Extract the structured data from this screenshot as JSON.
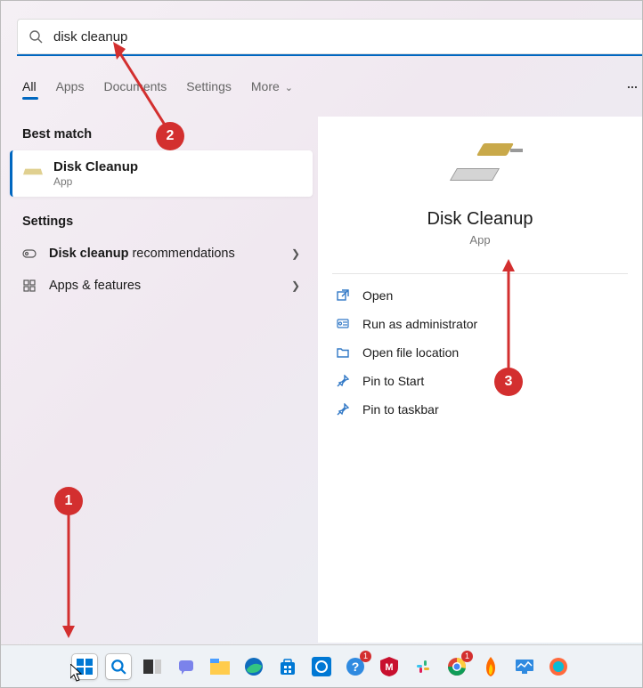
{
  "search": {
    "value": "disk cleanup"
  },
  "tabs": {
    "all": "All",
    "apps": "Apps",
    "documents": "Documents",
    "settings": "Settings",
    "more": "More"
  },
  "headers": {
    "best_match": "Best match",
    "settings": "Settings"
  },
  "best": {
    "title": "Disk Cleanup",
    "sub": "App"
  },
  "settings_items": {
    "rec_bold": "Disk cleanup",
    "rec_rest": " recommendations",
    "apps_features": "Apps & features"
  },
  "detail": {
    "title": "Disk Cleanup",
    "sub": "App"
  },
  "actions": {
    "open": "Open",
    "run_admin": "Run as administrator",
    "open_loc": "Open file location",
    "pin_start": "Pin to Start",
    "pin_taskbar": "Pin to taskbar"
  },
  "callouts": {
    "one": "1",
    "two": "2",
    "three": "3"
  },
  "overflow": "···",
  "more_chevron": "⌄",
  "taskbar_badges": {
    "help": "1",
    "chrome": "1"
  }
}
